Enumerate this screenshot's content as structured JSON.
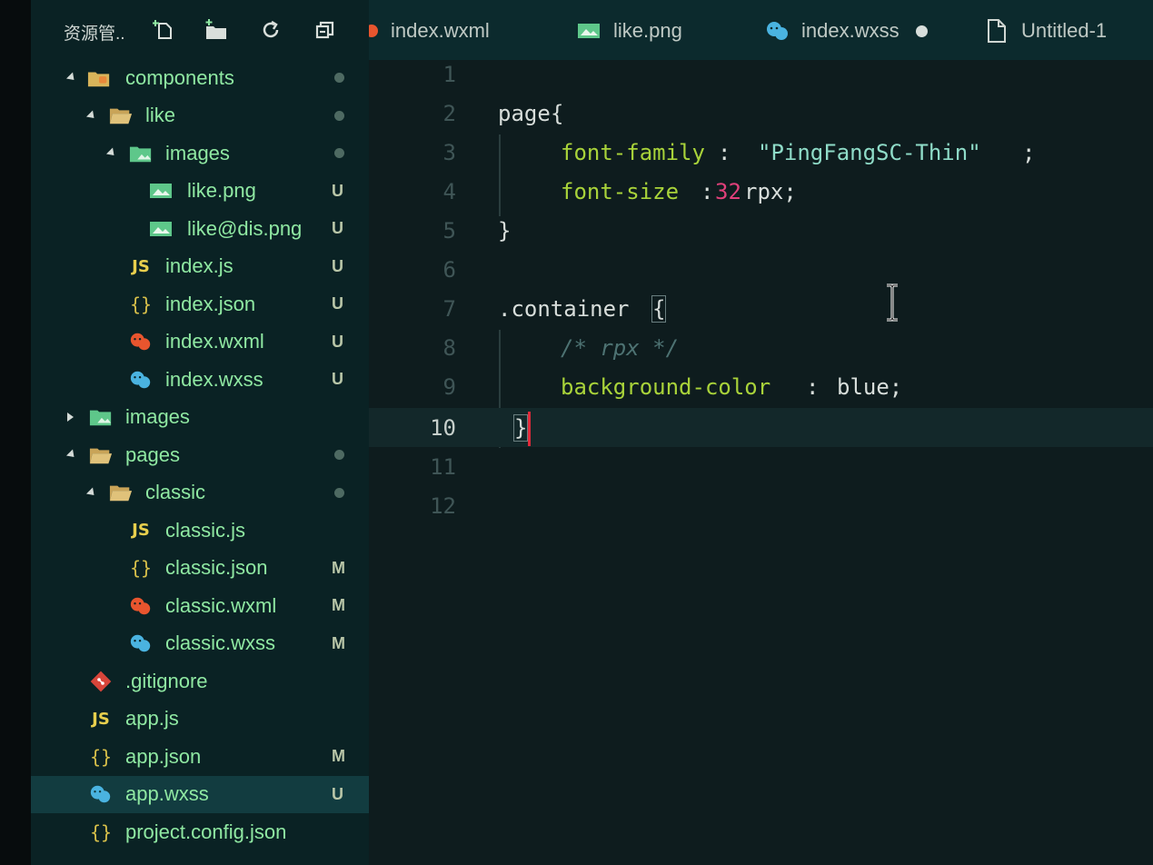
{
  "sidebar": {
    "title": "资源管..",
    "header_icons": [
      "new-file-icon",
      "new-folder-icon",
      "refresh-icon",
      "collapse-all-icon"
    ],
    "items": [
      {
        "label": "components",
        "badge": "",
        "dot": true,
        "icon": "folder-component-icon"
      },
      {
        "label": "like",
        "badge": "",
        "dot": true,
        "icon": "folder-open-icon"
      },
      {
        "label": "images",
        "badge": "",
        "dot": true,
        "icon": "folder-images-icon"
      },
      {
        "label": "like.png",
        "badge": "U",
        "dot": false,
        "icon": "image-file-icon"
      },
      {
        "label": "like@dis.png",
        "badge": "U",
        "dot": false,
        "icon": "image-file-icon"
      },
      {
        "label": "index.js",
        "badge": "U",
        "dot": false,
        "icon": "js-file-icon"
      },
      {
        "label": "index.json",
        "badge": "U",
        "dot": false,
        "icon": "json-file-icon"
      },
      {
        "label": "index.wxml",
        "badge": "U",
        "dot": false,
        "icon": "wxml-file-icon"
      },
      {
        "label": "index.wxss",
        "badge": "U",
        "dot": false,
        "icon": "wxss-file-icon"
      },
      {
        "label": "images",
        "badge": "",
        "dot": false,
        "icon": "folder-images-icon"
      },
      {
        "label": "pages",
        "badge": "",
        "dot": true,
        "icon": "folder-open-icon"
      },
      {
        "label": "classic",
        "badge": "",
        "dot": true,
        "icon": "folder-open-icon"
      },
      {
        "label": "classic.js",
        "badge": "",
        "dot": false,
        "icon": "js-file-icon"
      },
      {
        "label": "classic.json",
        "badge": "M",
        "dot": false,
        "icon": "json-file-icon"
      },
      {
        "label": "classic.wxml",
        "badge": "M",
        "dot": false,
        "icon": "wxml-file-icon"
      },
      {
        "label": "classic.wxss",
        "badge": "M",
        "dot": false,
        "icon": "wxss-file-icon"
      },
      {
        "label": ".gitignore",
        "badge": "",
        "dot": false,
        "icon": "git-file-icon"
      },
      {
        "label": "app.js",
        "badge": "",
        "dot": false,
        "icon": "js-file-icon"
      },
      {
        "label": "app.json",
        "badge": "M",
        "dot": false,
        "icon": "json-file-icon"
      },
      {
        "label": "app.wxss",
        "badge": "U",
        "dot": false,
        "icon": "wxss-file-icon"
      },
      {
        "label": "project.config.json",
        "badge": "",
        "dot": false,
        "icon": "json-file-icon"
      }
    ]
  },
  "tabs": [
    {
      "label": "index.wxml",
      "icon": "wxml-file-icon"
    },
    {
      "label": "like.png",
      "icon": "image-file-icon"
    },
    {
      "label": "index.wxss",
      "icon": "wxss-file-icon",
      "modified": true
    },
    {
      "label": "Untitled-1",
      "icon": "document-icon"
    }
  ],
  "editor": {
    "line_numbers": [
      "1",
      "2",
      "3",
      "4",
      "5",
      "6",
      "7",
      "8",
      "9",
      "10",
      "11",
      "12"
    ],
    "active_line": "10",
    "code": {
      "l2_selector": "page",
      "l2_brace": "{",
      "l3_prop": "font-family",
      "l3_colon": ": ",
      "l3_value": "\"PingFangSC-Thin\"",
      "l3_semi": ";",
      "l4_prop": "font-size",
      "l4_colon": ":",
      "l4_num": "32",
      "l4_unit": "rpx;",
      "l5_brace": "}",
      "l7_selector": ".container",
      "l7_brace": "{",
      "l8_comment": "/* rpx */",
      "l9_prop": "background-color",
      "l9_colon": ": ",
      "l9_value": "blue;",
      "l10_brace": "}"
    }
  },
  "colors": {
    "property": "#a9d33a",
    "string": "#8fdcc8",
    "number": "#e0407a",
    "comment": "#4d7272",
    "text": "#d8dedb",
    "tree_label": "#8fe8a2"
  }
}
